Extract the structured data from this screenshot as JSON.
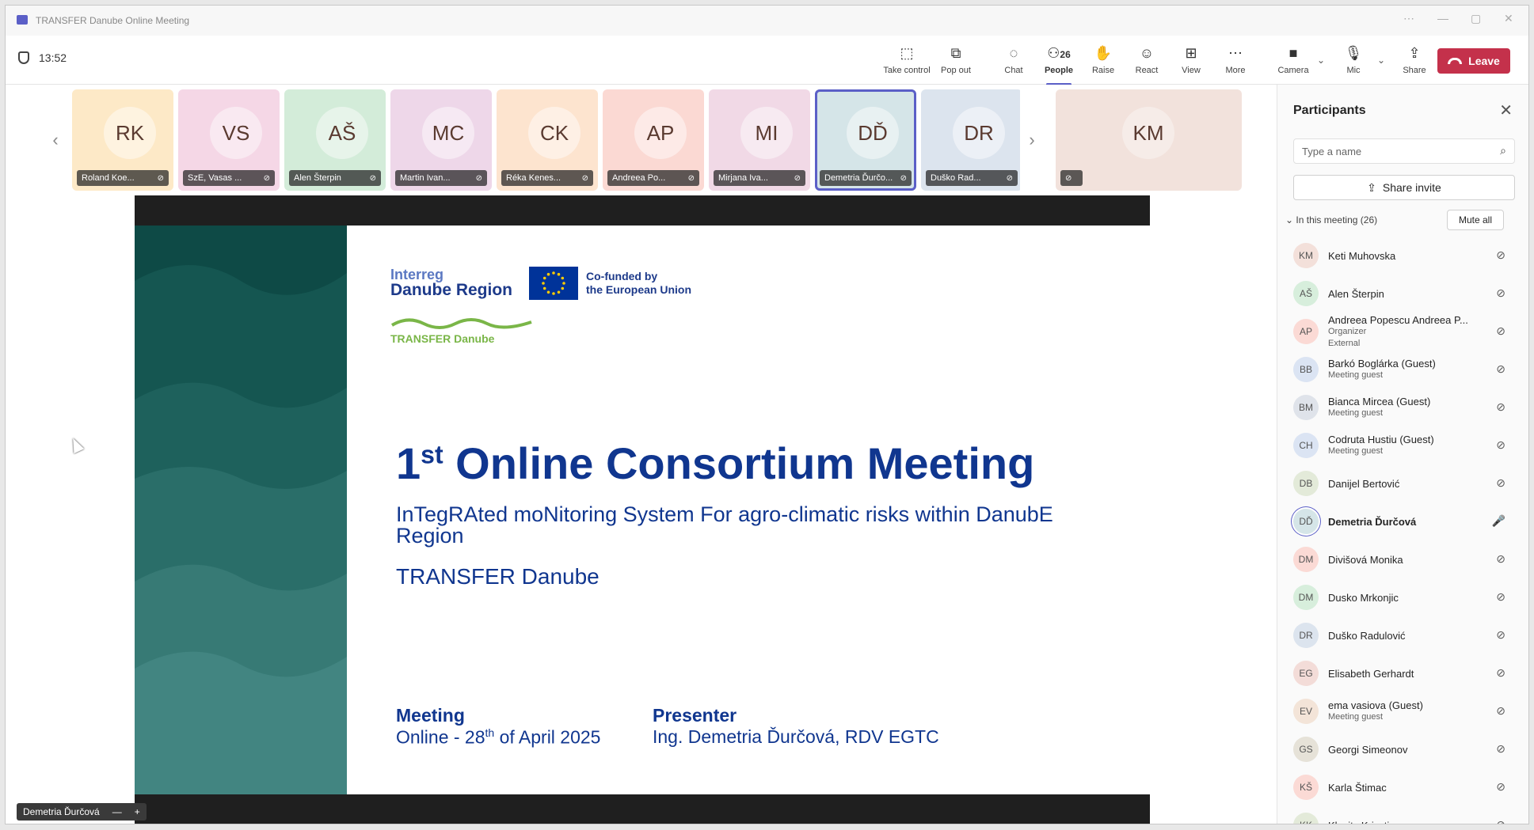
{
  "window": {
    "title": "TRANSFER Danube Online Meeting"
  },
  "toolbar": {
    "time": "13:52",
    "people_count": "26",
    "buttons": {
      "take_control": "Take control",
      "pop_out": "Pop out",
      "chat": "Chat",
      "people": "People",
      "raise": "Raise",
      "react": "React",
      "view": "View",
      "more": "More",
      "camera": "Camera",
      "mic": "Mic",
      "share": "Share",
      "leave": "Leave"
    }
  },
  "video_strip": {
    "tiles": [
      {
        "initials": "RK",
        "name": "Roland Koe...",
        "color": "#fde9c7"
      },
      {
        "initials": "VS",
        "name": "SzE, Vasas ...",
        "color": "#f5d7e6"
      },
      {
        "initials": "AŠ",
        "name": "Alen Šterpin",
        "color": "#d3ecd9"
      },
      {
        "initials": "MC",
        "name": "Martin Ivan...",
        "color": "#eed7e9"
      },
      {
        "initials": "CK",
        "name": "Réka Kenes...",
        "color": "#fde4cf"
      },
      {
        "initials": "AP",
        "name": "Andreea Po...",
        "color": "#fbd9d3"
      },
      {
        "initials": "MI",
        "name": "Mirjana Iva...",
        "color": "#f1d9e6"
      },
      {
        "initials": "DĎ",
        "name": "Demetria Ďurčo...",
        "color": "#d5e5e8"
      },
      {
        "initials": "DR",
        "name": "Duško Rad...",
        "color": "#dce4ee"
      }
    ],
    "featured": {
      "initials": "KM",
      "color": "#f2e2dc"
    }
  },
  "slide": {
    "interreg_line1": "Interreg",
    "interreg_line2": "Danube Region",
    "eu_line1": "Co-funded by",
    "eu_line2": "the European Union",
    "transfer_logo": "TRANSFER Danube",
    "title_num": "1",
    "title_sup": "st",
    "title_rest": " Online Consortium Meeting",
    "subtitle": "InTegRAted moNitoring System For agro-climatic risks within DanubE Region",
    "project": "TRANSFER Danube",
    "meeting_label": "Meeting",
    "meeting_pre": "Online - 28",
    "meeting_sup": "th",
    "meeting_post": " of April 2025",
    "presenter_label": "Presenter",
    "presenter_value": "Ing. Demetria Ďurčová, RDV EGTC"
  },
  "speaker_label": "Demetria Ďurčová",
  "panel": {
    "title": "Participants",
    "search_placeholder": "Type a name",
    "share_invite": "Share invite",
    "in_meeting": "In this meeting (26)",
    "mute_all": "Mute all",
    "participants": [
      {
        "initials": "KM",
        "name": "Keti Muhovska",
        "sub1": "",
        "sub2": "",
        "color": "#f3e0da",
        "speaking": false
      },
      {
        "initials": "AŠ",
        "name": "Alen Šterpin",
        "sub1": "",
        "sub2": "",
        "color": "#d7eedc",
        "speaking": false
      },
      {
        "initials": "AP",
        "name": "Andreea Popescu Andreea P...",
        "sub1": "Organizer",
        "sub2": "External",
        "color": "#fbdad5",
        "speaking": false
      },
      {
        "initials": "BB",
        "name": "Barkó Boglárka (Guest)",
        "sub1": "Meeting guest",
        "sub2": "",
        "color": "#dbe4f3",
        "speaking": false
      },
      {
        "initials": "BM",
        "name": "Bianca Mircea (Guest)",
        "sub1": "Meeting guest",
        "sub2": "",
        "color": "#dfe3ea",
        "speaking": false
      },
      {
        "initials": "CH",
        "name": "Codruta Hustiu (Guest)",
        "sub1": "Meeting guest",
        "sub2": "",
        "color": "#dbe4f3",
        "speaking": false
      },
      {
        "initials": "DB",
        "name": "Danijel Bertović",
        "sub1": "",
        "sub2": "",
        "color": "#e3ead9",
        "speaking": false
      },
      {
        "initials": "DĎ",
        "name": "Demetria Ďurčová",
        "sub1": "",
        "sub2": "",
        "color": "#d5e5e8",
        "speaking": true
      },
      {
        "initials": "DM",
        "name": "Divišová Monika",
        "sub1": "",
        "sub2": "",
        "color": "#fbdad5",
        "speaking": false
      },
      {
        "initials": "DM",
        "name": "Dusko Mrkonjic",
        "sub1": "",
        "sub2": "",
        "color": "#d7eedc",
        "speaking": false
      },
      {
        "initials": "DR",
        "name": "Duško Radulović",
        "sub1": "",
        "sub2": "",
        "color": "#dce4ee",
        "speaking": false
      },
      {
        "initials": "EG",
        "name": "Elisabeth Gerhardt",
        "sub1": "",
        "sub2": "",
        "color": "#f3dcd8",
        "speaking": false
      },
      {
        "initials": "EV",
        "name": "ema vasiova (Guest)",
        "sub1": "Meeting guest",
        "sub2": "",
        "color": "#f3e4d8",
        "speaking": false
      },
      {
        "initials": "GS",
        "name": "Georgi Simeonov",
        "sub1": "",
        "sub2": "",
        "color": "#e6e2d8",
        "speaking": false
      },
      {
        "initials": "KŠ",
        "name": "Karla Štimac",
        "sub1": "",
        "sub2": "",
        "color": "#fbdad5",
        "speaking": false
      },
      {
        "initials": "KK",
        "name": "Klesitz Krisztina",
        "sub1": "",
        "sub2": "",
        "color": "#e3ead9",
        "speaking": false
      }
    ]
  },
  "colors": {
    "accent": "#5b5fc7",
    "leave": "#c4314b",
    "slide_text": "#10368f",
    "slide_band": "#0e4a46"
  }
}
